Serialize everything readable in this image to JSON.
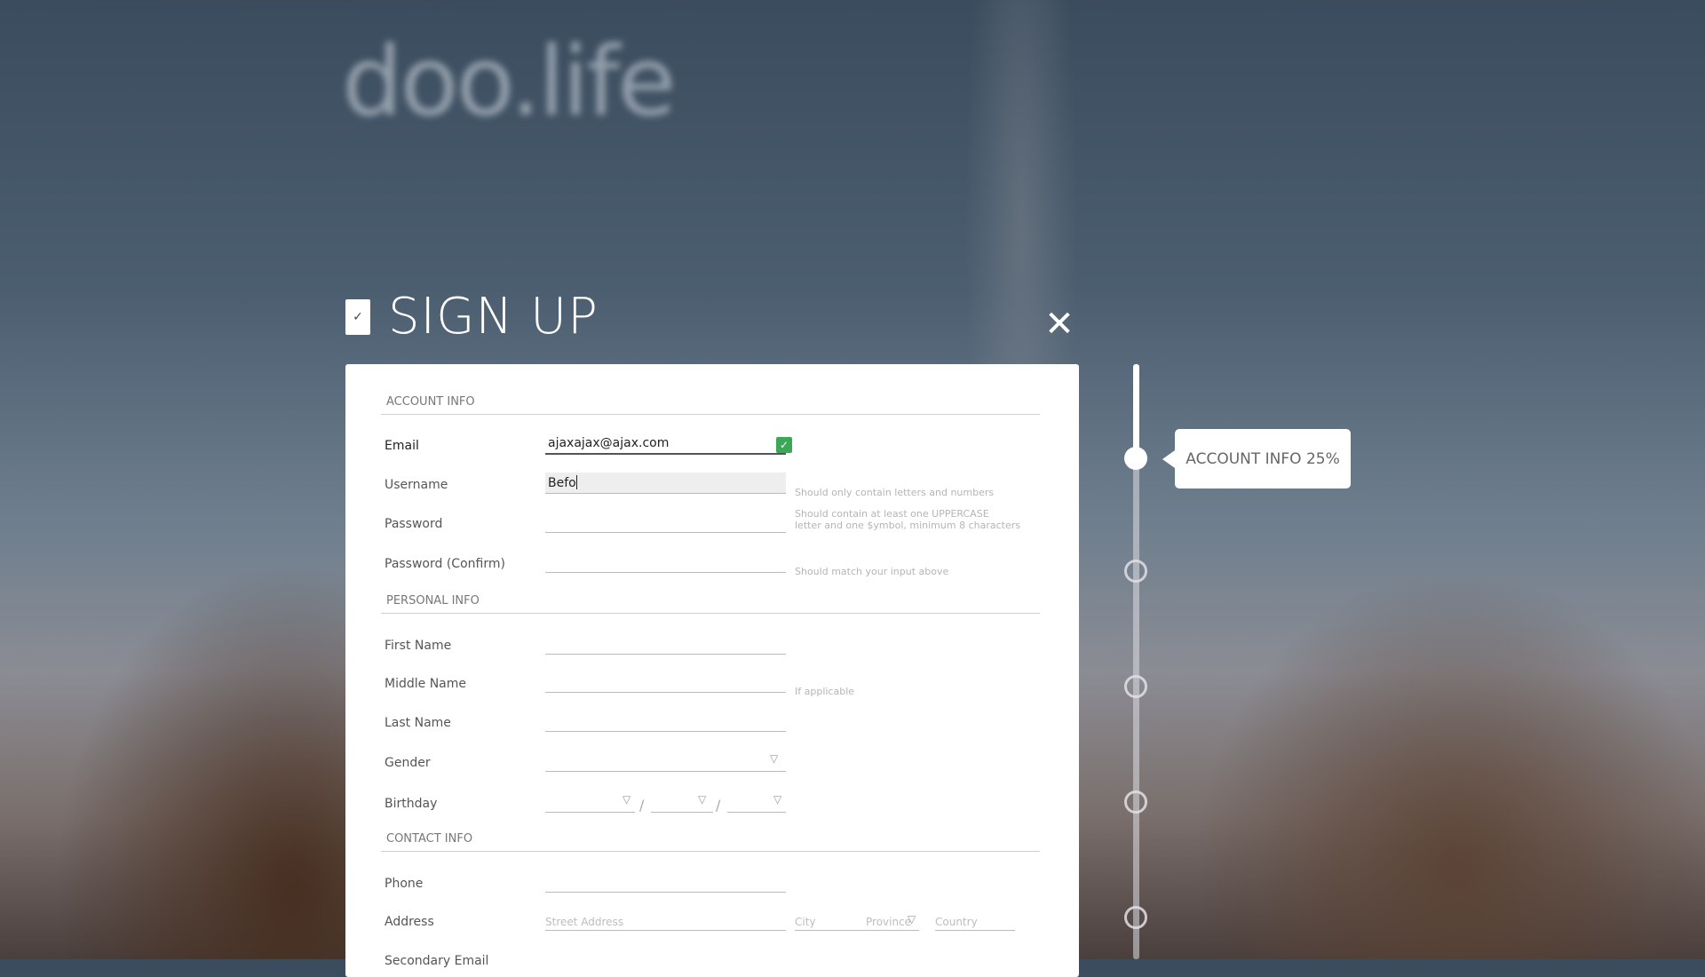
{
  "logo": "doo.life",
  "header": {
    "title": "SIGN UP",
    "close": "✕",
    "check": "✓"
  },
  "sections": {
    "account": "ACCOUNT INFO",
    "personal": "PERSONAL INFO",
    "contact": "CONTACT INFO"
  },
  "fields": {
    "email": {
      "label": "Email",
      "value": "ajaxajax@ajax.com",
      "valid": true
    },
    "username": {
      "label": "Username",
      "value": "Befo",
      "hint": "Should only contain letters and numbers"
    },
    "password": {
      "label": "Password",
      "hint_line1": "Should contain at least one UPPERCASE",
      "hint_line2": "letter and one $ymbol, minimum 8 characters"
    },
    "password_confirm": {
      "label": "Password (Confirm)",
      "hint": "Should match your input above"
    },
    "first_name": {
      "label": "First Name"
    },
    "middle_name": {
      "label": "Middle Name",
      "hint": "If applicable"
    },
    "last_name": {
      "label": "Last Name"
    },
    "gender": {
      "label": "Gender"
    },
    "birthday": {
      "label": "Birthday",
      "separator": "/"
    },
    "phone": {
      "label": "Phone"
    },
    "address": {
      "label": "Address",
      "street_placeholder": "Street Address",
      "city_placeholder": "City",
      "province_placeholder": "Province",
      "country_placeholder": "Country"
    },
    "secondary_email": {
      "label": "Secondary Email"
    }
  },
  "progress": {
    "label": "ACCOUNT INFO 25%",
    "percent": 25
  }
}
